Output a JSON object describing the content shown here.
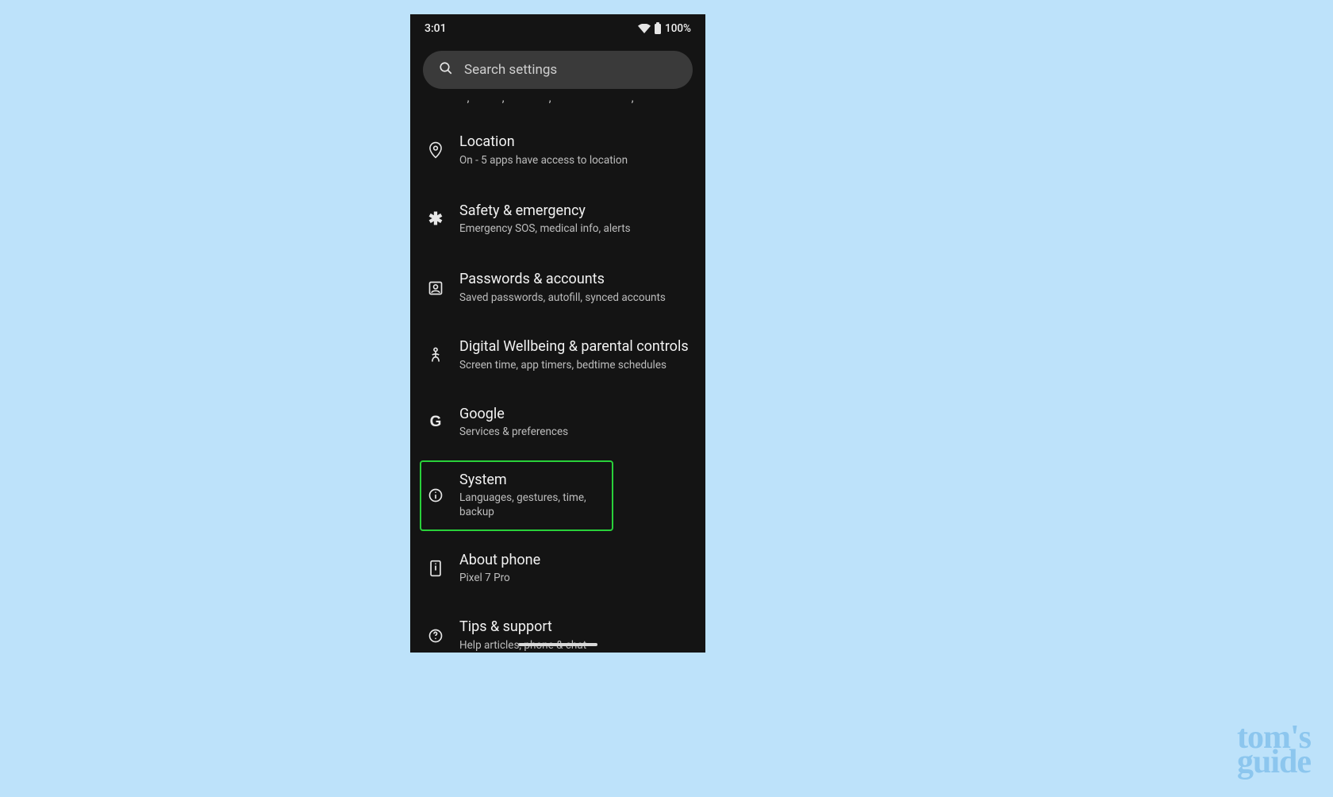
{
  "status": {
    "time": "3:01",
    "battery": "100%"
  },
  "search": {
    "placeholder": "Search settings"
  },
  "items": [
    {
      "title": "Location",
      "subtitle": "On - 5 apps have access to location"
    },
    {
      "title": "Safety & emergency",
      "subtitle": "Emergency SOS, medical info, alerts"
    },
    {
      "title": "Passwords & accounts",
      "subtitle": "Saved passwords, autofill, synced accounts"
    },
    {
      "title": "Digital Wellbeing & parental controls",
      "subtitle": "Screen time, app timers, bedtime schedules"
    },
    {
      "title": "Google",
      "subtitle": "Services & preferences"
    },
    {
      "title": "System",
      "subtitle": "Languages, gestures, time, backup"
    },
    {
      "title": "About phone",
      "subtitle": "Pixel 7 Pro"
    },
    {
      "title": "Tips & support",
      "subtitle": "Help articles, phone & chat"
    }
  ],
  "watermark": {
    "line1": "tom's",
    "line2": "guide"
  }
}
